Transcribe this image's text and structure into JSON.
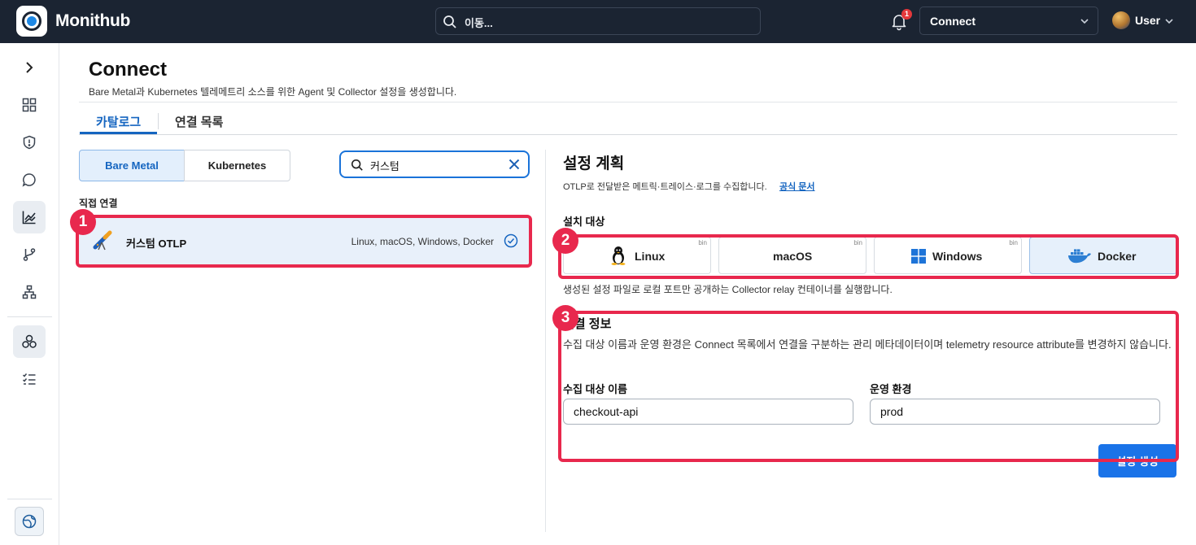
{
  "topbar": {
    "brand": "Monithub",
    "search_placeholder": "이동...",
    "notification_count": "1",
    "context_select": "Connect",
    "user_label": "User"
  },
  "sidebar": {
    "icons": [
      "expand-chevron-icon",
      "dashboard-icon",
      "shield-alert-icon",
      "chat-icon",
      "chart-icon",
      "branch-icon",
      "hierarchy-icon",
      "cluster-icon",
      "checklist-icon",
      "globe-icon"
    ],
    "active": [
      "chart-icon",
      "cluster-icon"
    ]
  },
  "header": {
    "title": "Connect",
    "subtitle": "Bare Metal과 Kubernetes 텔레메트리 소스를 위한 Agent 및 Collector 설정을 생성합니다."
  },
  "tabs": [
    {
      "label": "카탈로그",
      "active": true
    },
    {
      "label": "연결 목록",
      "active": false
    }
  ],
  "catalog": {
    "segments": [
      {
        "label": "Bare Metal",
        "active": true
      },
      {
        "label": "Kubernetes",
        "active": false
      }
    ],
    "filter_value": "커스텀",
    "group_label": "직접 연결",
    "item": {
      "name": "커스텀 OTLP",
      "platforms": "Linux, macOS, Windows, Docker"
    }
  },
  "plan": {
    "title": "설정 계획",
    "description": "OTLP로 전달받은 메트릭·트레이스·로그를 수집합니다.",
    "doc_link": "공식 문서",
    "target_heading": "설치 대상",
    "targets": [
      {
        "label": "Linux",
        "badge": "bin",
        "selected": false
      },
      {
        "label": "macOS",
        "badge": "bin",
        "selected": false
      },
      {
        "label": "Windows",
        "badge": "bin",
        "selected": false
      },
      {
        "label": "Docker",
        "badge": "",
        "selected": true
      }
    ],
    "target_note": "생성된 설정 파일로 로컬 포트만 공개하는 Collector relay 컨테이너를 실행합니다.",
    "conn_heading": "연결 정보",
    "conn_desc": "수집 대상 이름과 운영 환경은 Connect 목록에서 연결을 구분하는 관리 메타데이터이며 telemetry resource attribute를 변경하지 않습니다.",
    "fields": [
      {
        "label": "수집 대상 이름",
        "value": "checkout-api"
      },
      {
        "label": "운영 환경",
        "value": "prod"
      }
    ],
    "generate_button": "설정 생성"
  },
  "annotations": [
    {
      "number": "1",
      "target": "catalog item"
    },
    {
      "number": "2",
      "target": "install targets"
    },
    {
      "number": "3",
      "target": "connection info"
    }
  ],
  "colors": {
    "accent": "#1565c0",
    "topbar": "#1b2432",
    "highlight": "#e8284d",
    "primary_button": "#1a73e8"
  }
}
